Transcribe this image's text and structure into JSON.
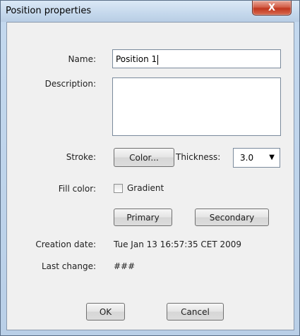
{
  "window": {
    "title": "Position properties",
    "close_icon": "close-icon",
    "close_glyph": "X"
  },
  "form": {
    "name": {
      "label": "Name:",
      "value": "Position 1"
    },
    "description": {
      "label": "Description:",
      "value": ""
    },
    "stroke": {
      "label": "Stroke:",
      "color_button": "Color...",
      "thickness_label": "Thickness:",
      "thickness_value": "3.0",
      "dropdown_icon": "chevron-down-icon",
      "dropdown_glyph": "▼"
    },
    "fill": {
      "label": "Fill color:",
      "gradient_label": "Gradient",
      "gradient_checked": false,
      "primary_button": "Primary",
      "secondary_button": "Secondary"
    },
    "creation_date": {
      "label": "Creation date:",
      "value": "Tue Jan 13 16:57:35 CET 2009"
    },
    "last_change": {
      "label": "Last change:",
      "value": "###"
    }
  },
  "buttons": {
    "ok": "OK",
    "cancel": "Cancel"
  }
}
